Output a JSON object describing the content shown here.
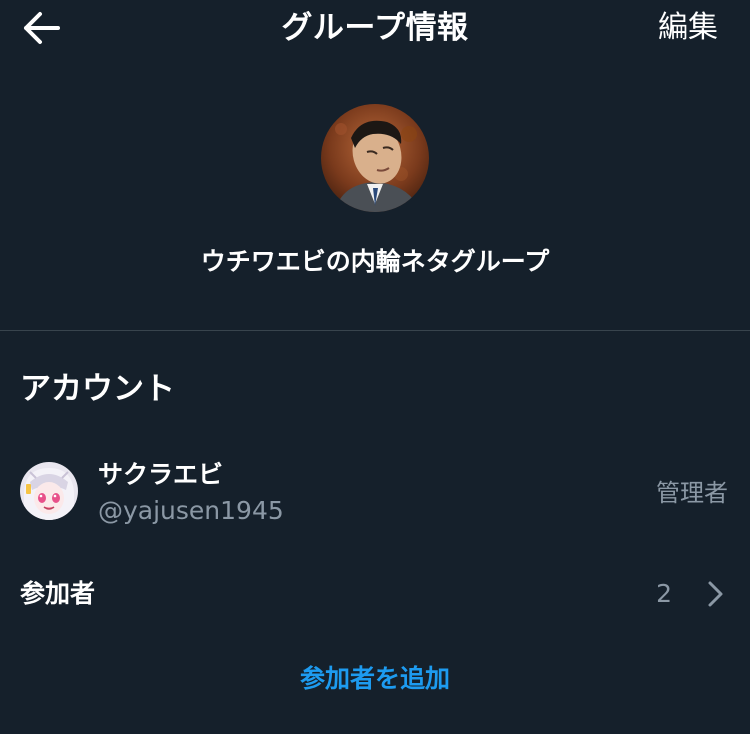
{
  "header": {
    "title": "グループ情報",
    "edit_label": "編集",
    "back_icon": "arrow-left-icon"
  },
  "group": {
    "name": "ウチワエビの内輪ネタグループ",
    "avatar": "group-photo"
  },
  "accounts_section": {
    "title": "アカウント",
    "members": [
      {
        "name": "サクラエビ",
        "handle": "@yajusen1945",
        "role": "管理者",
        "avatar": "anime-avatar"
      }
    ]
  },
  "participants": {
    "label": "参加者",
    "count": "2",
    "chevron_icon": "chevron-right-icon"
  },
  "add_participant_label": "参加者を追加",
  "colors": {
    "background": "#15202b",
    "text_primary": "#ffffff",
    "text_secondary": "#8b98a5",
    "accent": "#1d9bf0",
    "divider": "#38444d"
  }
}
